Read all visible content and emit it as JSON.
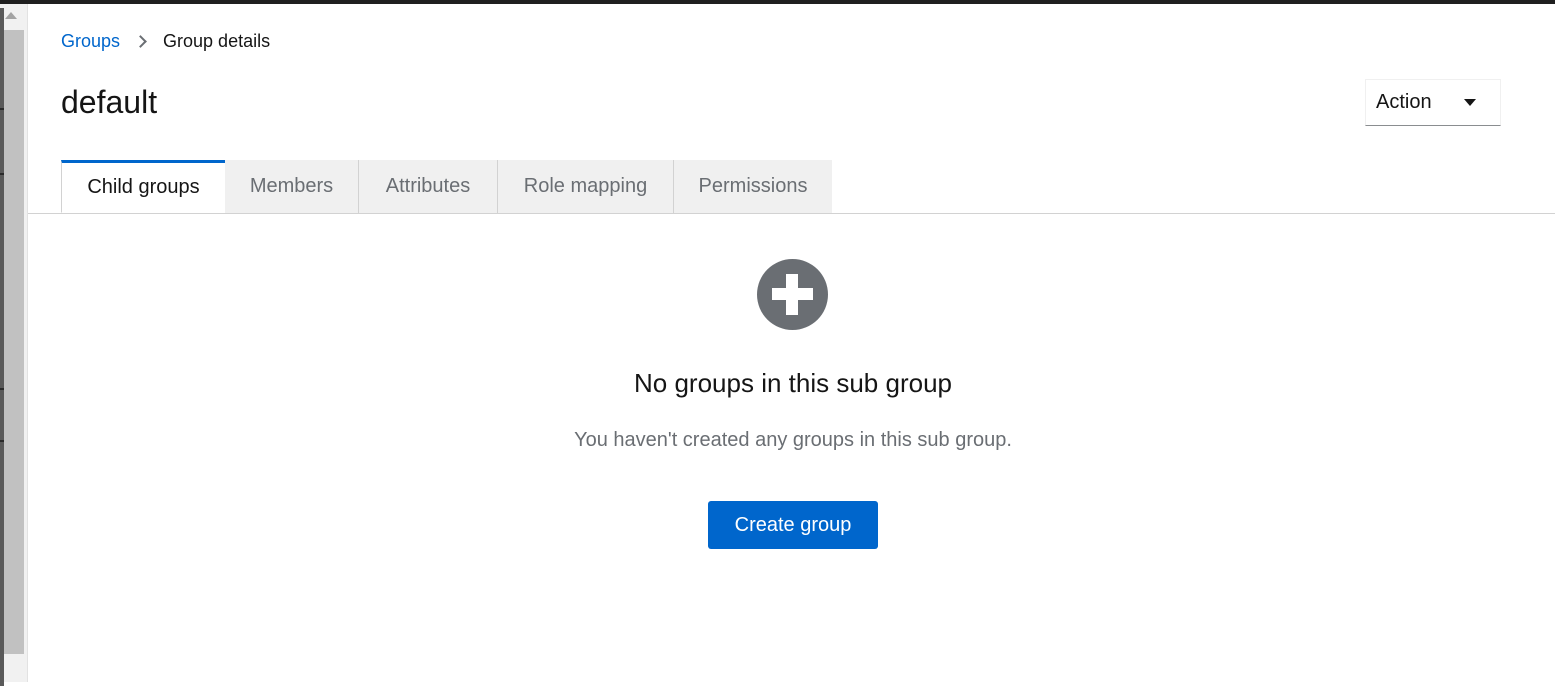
{
  "breadcrumb": {
    "parent": "Groups",
    "current": "Group details"
  },
  "page": {
    "title": "default"
  },
  "action_menu": {
    "label": "Action"
  },
  "tabs": [
    {
      "label": "Child groups",
      "active": true
    },
    {
      "label": "Members",
      "active": false
    },
    {
      "label": "Attributes",
      "active": false
    },
    {
      "label": "Role mapping",
      "active": false
    },
    {
      "label": "Permissions",
      "active": false
    }
  ],
  "empty_state": {
    "icon": "plus-circle-icon",
    "title": "No groups in this sub group",
    "body": "You haven't created any groups in this sub group.",
    "button_label": "Create group"
  },
  "colors": {
    "accent": "#0066cc",
    "icon_gray": "#6a6e73",
    "tab_inactive_bg": "#f0f0f0"
  }
}
